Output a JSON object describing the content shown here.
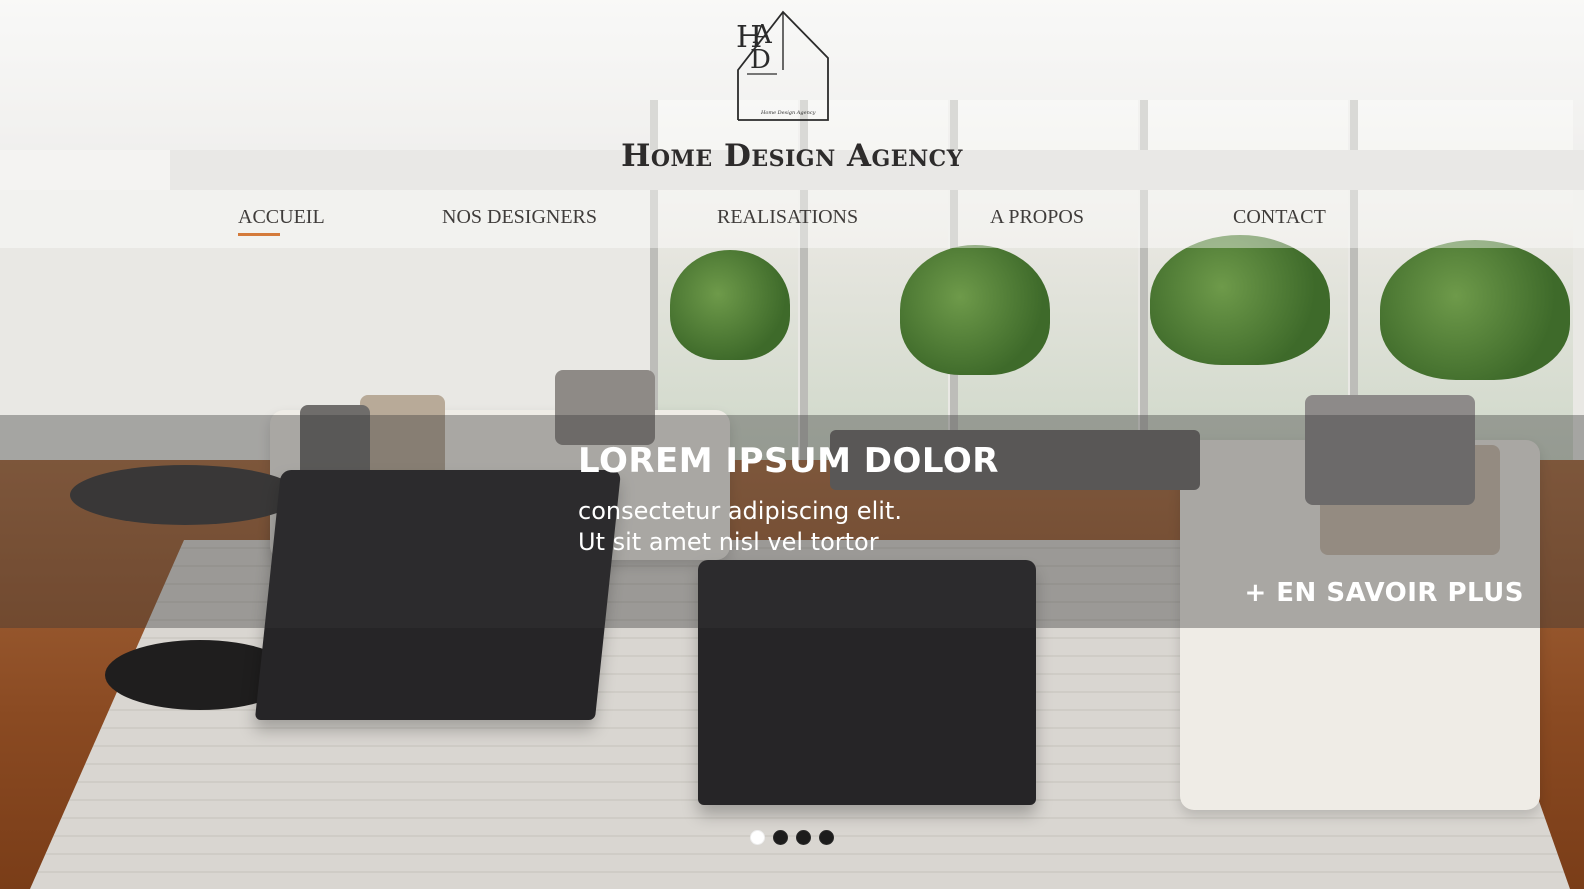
{
  "brand": {
    "name": "Home Design Agency",
    "logo_monogram": "HAD",
    "logo_tagline": "Home Design Agency"
  },
  "nav": {
    "items": [
      {
        "label": "ACCUEIL",
        "active": true
      },
      {
        "label": "NOS DESIGNERS",
        "active": false
      },
      {
        "label": "REALISATIONS",
        "active": false
      },
      {
        "label": "A PROPOS",
        "active": false
      },
      {
        "label": "CONTACT",
        "active": false
      }
    ],
    "active_underline_color": "#d47a3a"
  },
  "hero": {
    "title": "LOREM IPSUM DOLOR",
    "subtitle": "consectetur adipiscing elit.\nUt sit amet nisl vel tortor",
    "cta_label": "+ EN SAVOIR PLUS"
  },
  "carousel": {
    "slide_count": 4,
    "active_index": 0
  },
  "background_image": "living-room-interior"
}
